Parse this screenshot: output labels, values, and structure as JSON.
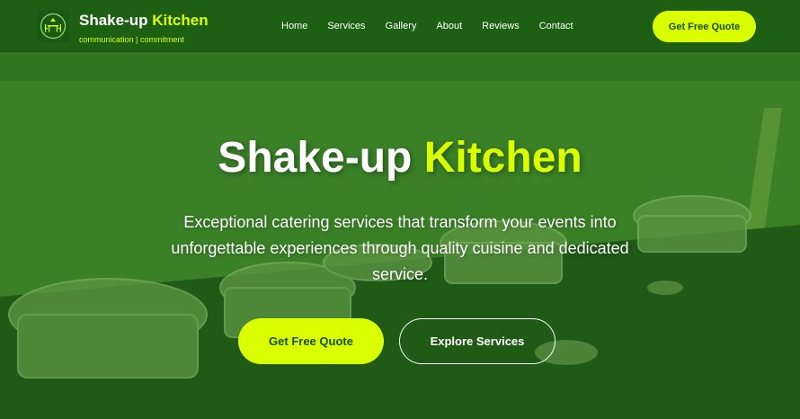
{
  "header": {
    "brand_name_main": "Shake-up",
    "brand_name_accent": "Kitchen",
    "tagline": "communication | commitment",
    "logo_icon": "dining-table-icon",
    "nav": [
      {
        "label": "Home"
      },
      {
        "label": "Services"
      },
      {
        "label": "Gallery"
      },
      {
        "label": "About"
      },
      {
        "label": "Reviews"
      },
      {
        "label": "Contact"
      }
    ],
    "cta_label": "Get Free Quote"
  },
  "hero": {
    "title_main": "Shake-up",
    "title_accent": "Kitchen",
    "description": "Exceptional catering services that transform your events into unforgettable experiences through quality cuisine and dedicated service.",
    "primary_button": "Get Free Quote",
    "secondary_button": "Explore Services",
    "background_image": "outdoor catering buffet chafing dishes on lawn"
  },
  "colors": {
    "accent": "#d9ff00",
    "header_bg": "#1c5e14",
    "overlay": "#226e16",
    "button_text": "#1a4d10"
  }
}
